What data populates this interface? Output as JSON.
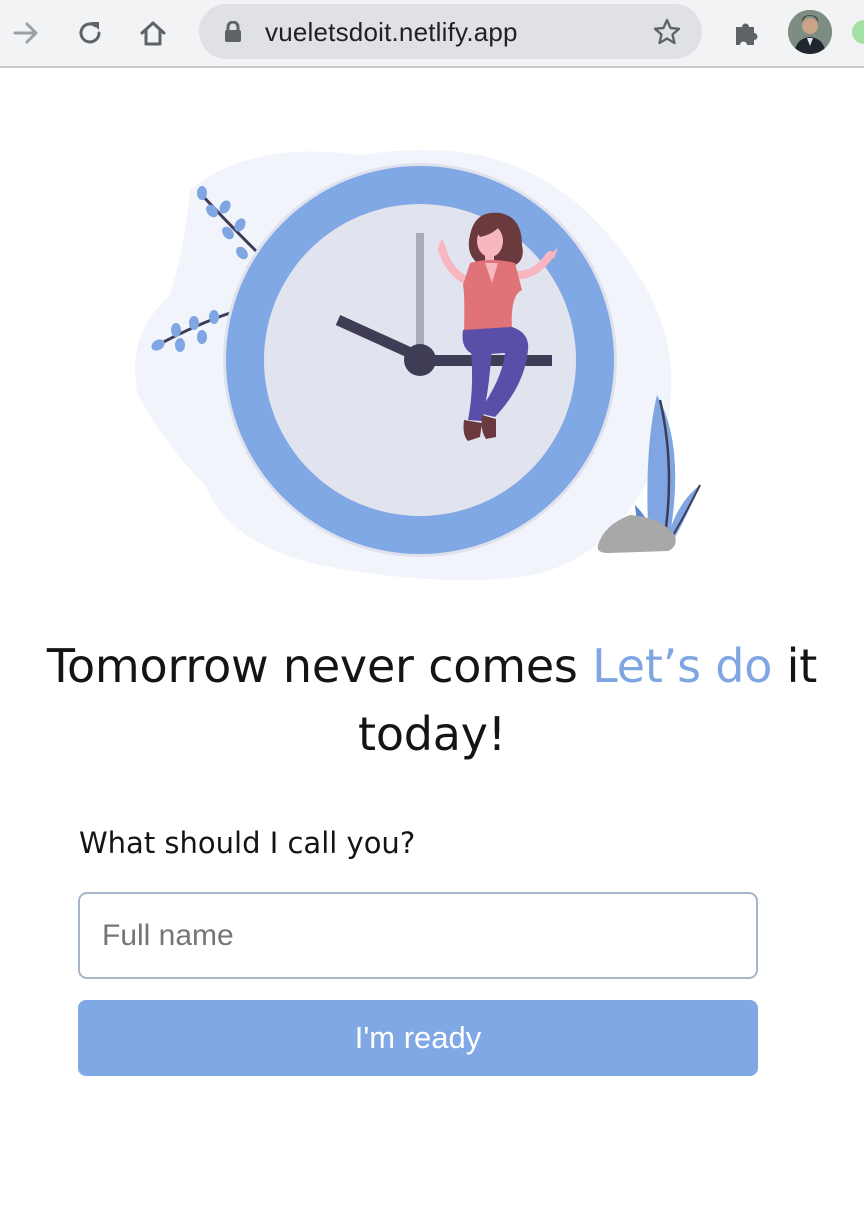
{
  "browser": {
    "url": "vueletsdoit.netlify.app"
  },
  "hero": {
    "headline_part1": "Tomorrow never comes ",
    "headline_accent": "Let’s do",
    "headline_part2": " it today!"
  },
  "form": {
    "label": "What should I call you?",
    "input_placeholder": "Full name",
    "input_value": "",
    "submit_label": "I'm ready"
  },
  "colors": {
    "accent": "#7fa6e2",
    "button": "#80a8e5",
    "text": "#141414"
  }
}
